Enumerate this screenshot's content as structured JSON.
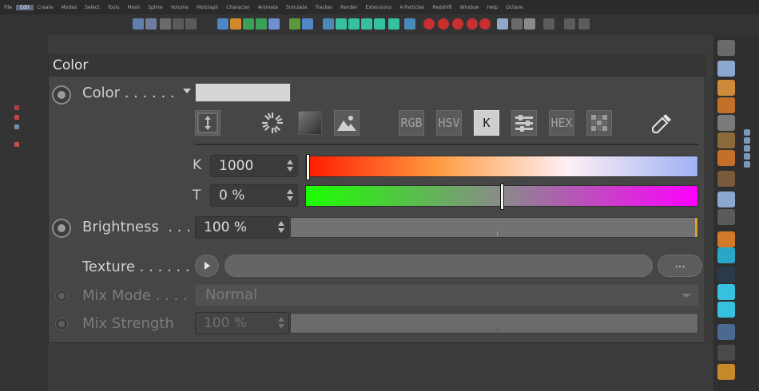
{
  "menubar": {
    "items": [
      "File",
      "Edit",
      "Create",
      "Modes",
      "Select",
      "Tools",
      "Mesh",
      "Spline",
      "Volume",
      "MoGraph",
      "Character",
      "Animate",
      "Simulate",
      "Tracker",
      "Render",
      "Extensions",
      "X-Particles",
      "Redshift",
      "Window",
      "Help",
      "Octane"
    ],
    "active_index": 1
  },
  "panel": {
    "title": "Color",
    "color_label": "Color . . . . . .",
    "swatch_color": "#d6d6d6",
    "modes": {
      "rgb": "RGB",
      "hsv": "HSV",
      "k": "K",
      "hex": "HEX",
      "active": "K"
    },
    "icons": [
      "spectrum-icon",
      "color-wheel-icon",
      "gradient-square-icon",
      "image-icon",
      "mixer-icon",
      "swatches-icon",
      "eyedropper-icon"
    ],
    "k_label": "K",
    "k_value": "1000",
    "k_slider_position": 0.0,
    "t_label": "T",
    "t_value": "0 %",
    "t_slider_position": 0.5,
    "brightness_label": "Brightness  . . .",
    "brightness_value": "100 %",
    "brightness_fraction": 1.0,
    "texture_label": "Texture . . . . . .",
    "texture_more": "...",
    "mix_mode_label": "Mix Mode . . . .",
    "mix_mode_value": "Normal",
    "mix_strength_label": "Mix Strength",
    "mix_strength_value": "100 %",
    "mix_strength_fraction": 1.0
  },
  "colors": {
    "accent": "#e0a030",
    "k_gradient": [
      "#ff1a00",
      "#ff9a40",
      "#fff0f4",
      "#9fb2f5"
    ],
    "t_gradient": [
      "#1cff00",
      "#8a8a8a",
      "#ff00ff"
    ]
  }
}
